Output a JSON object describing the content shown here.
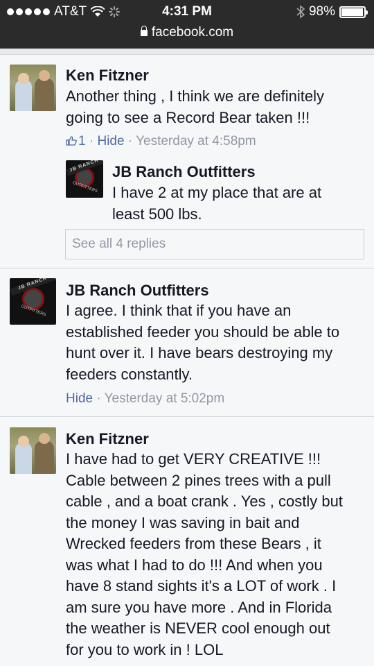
{
  "status_bar": {
    "carrier": "AT&T",
    "time": "4:31 PM",
    "battery": "98%",
    "battery_level": 0.98,
    "url": "facebook.com"
  },
  "comments": [
    {
      "author": "Ken Fitzner",
      "lines": [
        "Another thing , I think we are definitely",
        "going to see a Record Bear taken !!!"
      ],
      "like_count": "1",
      "sep": "·",
      "hide": "Hide",
      "time": "Yesterday at 4:58pm",
      "reply": {
        "author": "JB Ranch Outfitters",
        "lines": [
          "I have 2 at my place that are at",
          "least 500 lbs."
        ]
      },
      "see_replies": "See all 4 replies"
    },
    {
      "author": "JB Ranch Outfitters",
      "lines": [
        "I agree. I think that if you have an",
        "established feeder you should be able to",
        "hunt over it. I have bears destroying my",
        "feeders constantly."
      ],
      "hide": "Hide",
      "sep": "·",
      "time": "Yesterday at 5:02pm"
    },
    {
      "author": "Ken Fitzner",
      "lines": [
        "I have had to get VERY CREATIVE !!!",
        "Cable between 2 pines trees with a pull",
        "cable , and a boat crank . Yes , costly but",
        "the money I was saving in bait and",
        "Wrecked feeders from these Bears , it",
        "was what I had to do !!! And when you",
        "have 8 stand sights it's a LOT of work . I",
        "am sure you have more . And in Florida",
        "the weather is NEVER cool enough out",
        "for you to work in ! LOL"
      ]
    }
  ],
  "avatar_text": {
    "jb_top": "JB RANCH",
    "jb_bottom": "OUTFITTERS"
  }
}
